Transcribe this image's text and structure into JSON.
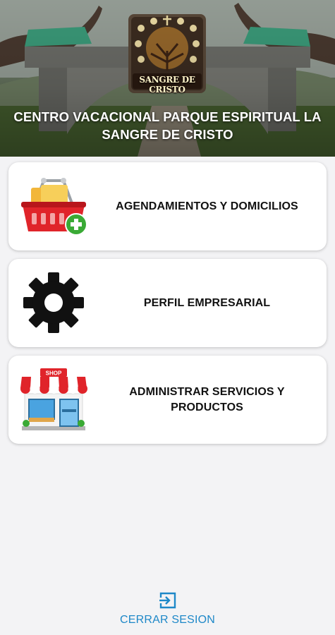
{
  "header": {
    "title": "CENTRO VACACIONAL PARQUE ESPIRITUAL LA SANGRE DE CRISTO",
    "logo_text": "SANGRE DE CRISTO"
  },
  "menu": [
    {
      "label": "AGENDAMIENTOS Y DOMICILIOS",
      "icon": "shopping-basket-add-icon"
    },
    {
      "label": "PERFIL EMPRESARIAL",
      "icon": "gear-icon"
    },
    {
      "label": "ADMINISTRAR SERVICIOS Y PRODUCTOS",
      "icon": "shop-store-icon",
      "icon_text": "SHOP"
    }
  ],
  "logout": {
    "label": "CERRAR SESION",
    "icon": "logout-icon"
  },
  "colors": {
    "accent": "#1e88c8",
    "card_background": "#ffffff",
    "page_background": "#f3f3f5",
    "basket_red": "#e0242a",
    "add_green": "#3aaa35"
  }
}
